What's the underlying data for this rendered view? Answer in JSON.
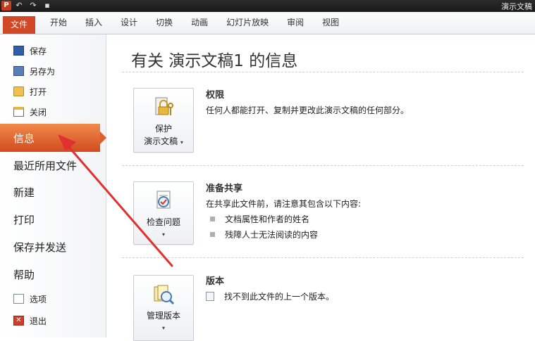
{
  "titlebar": {
    "app_logo": "P",
    "qat_icons": [
      "undo-icon",
      "redo-icon",
      "save-icon"
    ],
    "window_title": "演示文稿"
  },
  "ribbon": {
    "file_tab": "文件",
    "tabs": [
      "开始",
      "插入",
      "设计",
      "切换",
      "动画",
      "幻灯片放映",
      "审阅",
      "视图"
    ]
  },
  "nav": {
    "save": "保存",
    "save_as": "另存为",
    "open": "打开",
    "close": "关闭",
    "info": "信息",
    "recent": "最近所用文件",
    "new": "新建",
    "print": "打印",
    "save_send": "保存并发送",
    "help": "帮助",
    "options": "选项",
    "exit": "退出"
  },
  "content": {
    "page_title": "有关 演示文稿1 的信息",
    "permissions": {
      "button_line1": "保护",
      "button_line2": "演示文稿",
      "title": "权限",
      "text": "任何人都能打开、复制并更改此演示文稿的任何部分。"
    },
    "prepare": {
      "button_label": "检查问题",
      "title": "准备共享",
      "text": "在共享此文件前，请注意其包含以下内容:",
      "bullets": [
        "文档属性和作者的姓名",
        "残障人士无法阅读的内容"
      ]
    },
    "versions": {
      "button_label": "管理版本",
      "title": "版本",
      "text": "找不到此文件的上一个版本。"
    }
  },
  "colors": {
    "accent": "#d24726",
    "active_nav_top": "#f08a4a",
    "annotation_arrow": "#e03030"
  }
}
